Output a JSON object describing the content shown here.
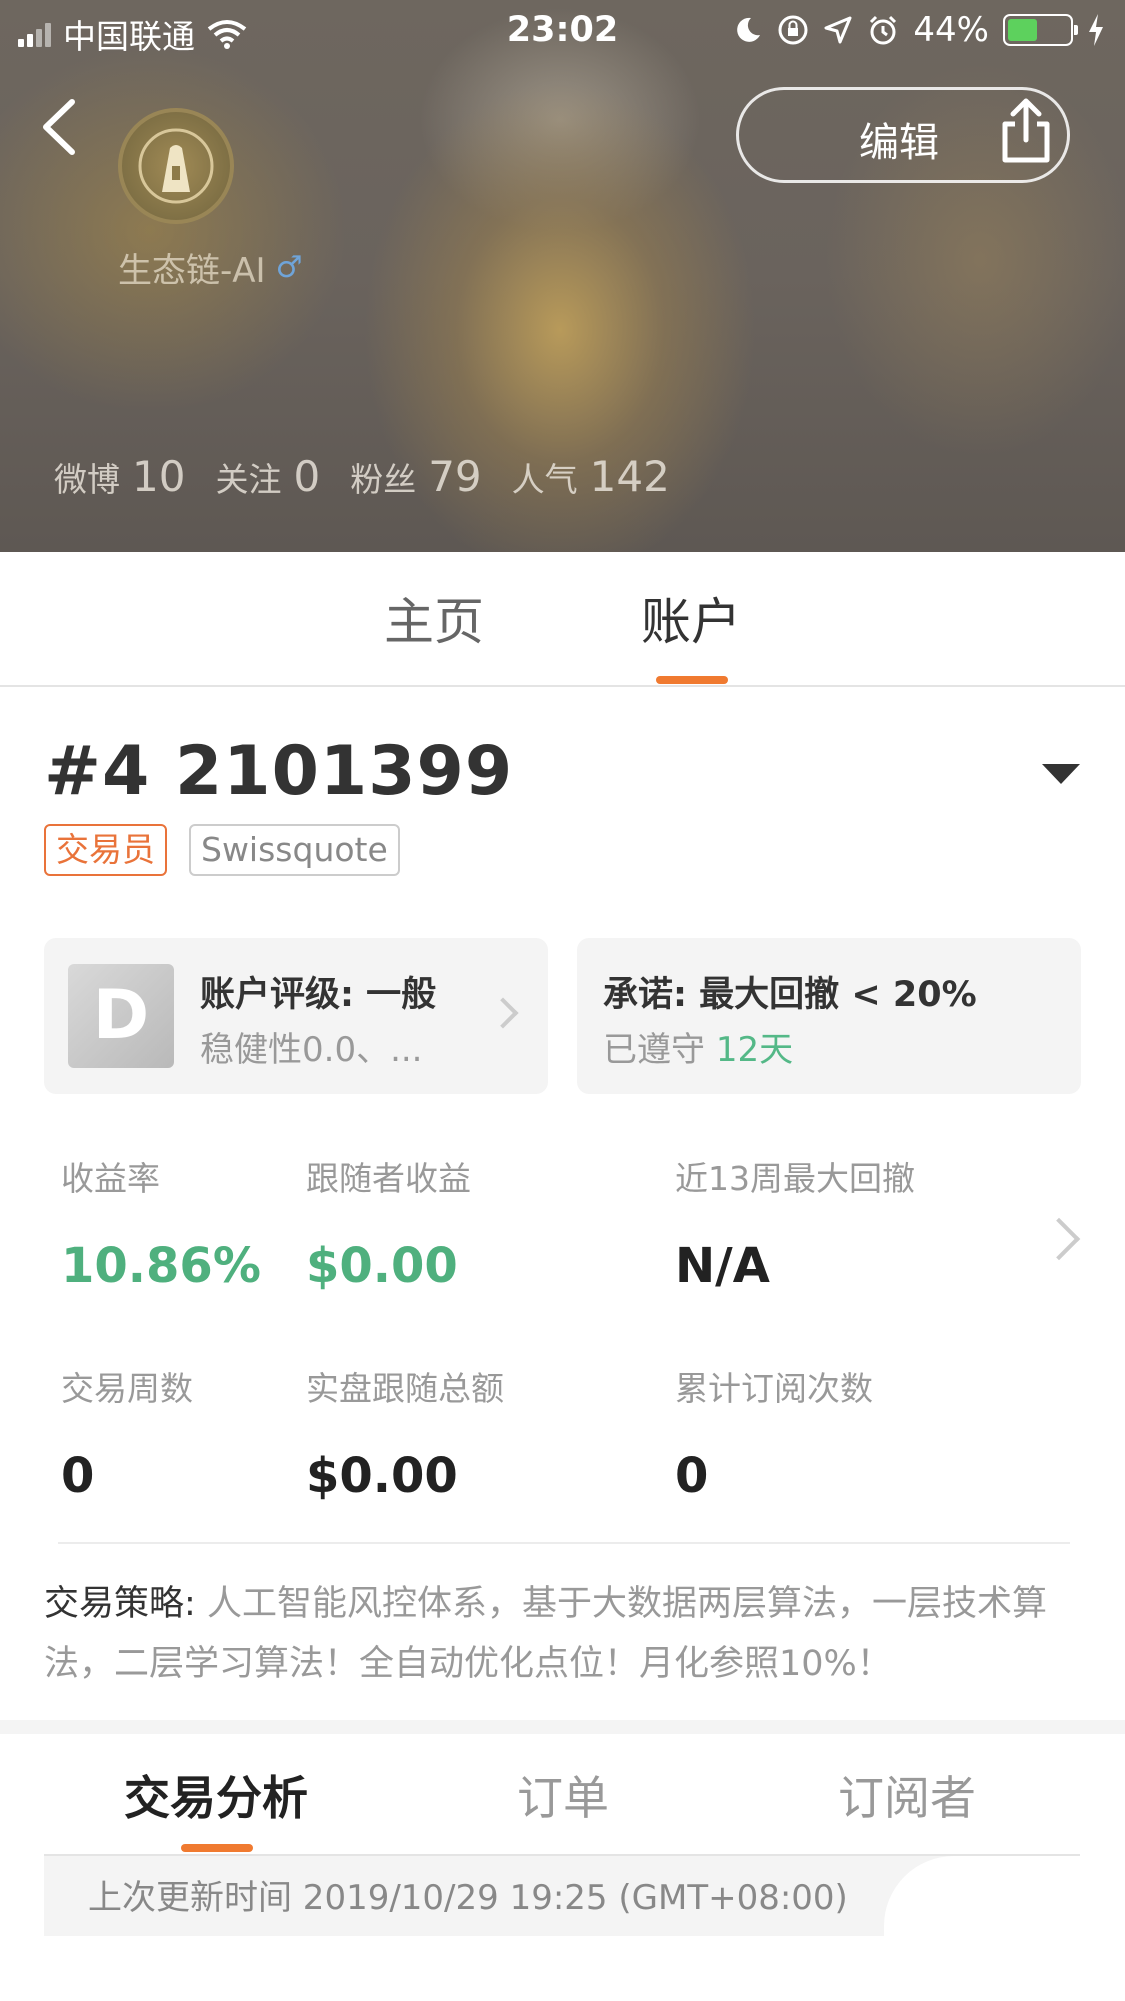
{
  "status_bar": {
    "carrier": "中国联通",
    "time": "23:02",
    "battery": "44%"
  },
  "header": {
    "username": "生态链-AI",
    "gender_symbol": "♂",
    "edit_label": "编辑",
    "stats": [
      {
        "label": "微博",
        "value": "10"
      },
      {
        "label": "关注",
        "value": "0"
      },
      {
        "label": "粉丝",
        "value": "79"
      },
      {
        "label": "人气",
        "value": "142"
      }
    ]
  },
  "main_tabs": [
    "主页",
    "账户"
  ],
  "account": {
    "title": "#4 2101399",
    "tags": [
      "交易员",
      "Swissquote"
    ],
    "rating_card": {
      "grade": "D",
      "title": "账户评级: 一般",
      "subtitle": "稳健性0.0、..."
    },
    "promise_card": {
      "title": "承诺: 最大回撤 < 20%",
      "subtitle_prefix": "已遵守",
      "days": "12天"
    },
    "metrics": [
      {
        "label": "收益率",
        "value": "10.86%"
      },
      {
        "label": "跟随者收益",
        "value": "$0.00"
      },
      {
        "label": "近13周最大回撤",
        "value": "N/A"
      },
      {
        "label": "交易周数",
        "value": "0"
      },
      {
        "label": "实盘跟随总额",
        "value": "$0.00"
      },
      {
        "label": "累计订阅次数",
        "value": "0"
      }
    ],
    "strategy_label": "交易策略:",
    "strategy_text": "人工智能风控体系，基于大数据两层算法，一层技术算法，二层学习算法！全自动优化点位！月化参照10%！"
  },
  "sub_tabs": [
    "交易分析",
    "订单",
    "订阅者"
  ],
  "last_update": "上次更新时间 2019/10/29 19:25 (GMT+08:00)",
  "colors": {
    "accent": "#f07a30",
    "positive": "#4fb07e"
  }
}
